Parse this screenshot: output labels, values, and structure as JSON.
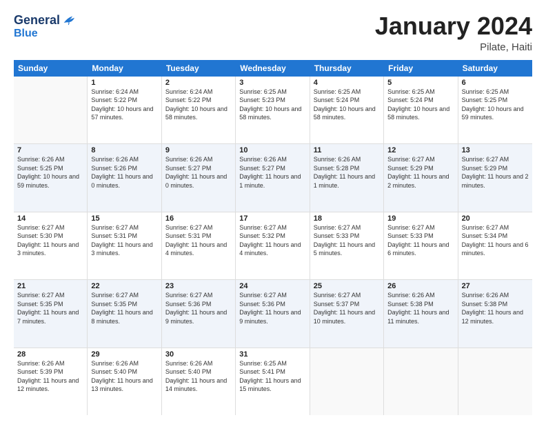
{
  "header": {
    "logo_line1": "General",
    "logo_line2": "Blue",
    "month_title": "January 2024",
    "subtitle": "Pilate, Haiti"
  },
  "weekdays": [
    "Sunday",
    "Monday",
    "Tuesday",
    "Wednesday",
    "Thursday",
    "Friday",
    "Saturday"
  ],
  "weeks": [
    [
      {
        "day": "",
        "sunrise": "",
        "sunset": "",
        "daylight": ""
      },
      {
        "day": "1",
        "sunrise": "Sunrise: 6:24 AM",
        "sunset": "Sunset: 5:22 PM",
        "daylight": "Daylight: 10 hours and 57 minutes."
      },
      {
        "day": "2",
        "sunrise": "Sunrise: 6:24 AM",
        "sunset": "Sunset: 5:22 PM",
        "daylight": "Daylight: 10 hours and 58 minutes."
      },
      {
        "day": "3",
        "sunrise": "Sunrise: 6:25 AM",
        "sunset": "Sunset: 5:23 PM",
        "daylight": "Daylight: 10 hours and 58 minutes."
      },
      {
        "day": "4",
        "sunrise": "Sunrise: 6:25 AM",
        "sunset": "Sunset: 5:24 PM",
        "daylight": "Daylight: 10 hours and 58 minutes."
      },
      {
        "day": "5",
        "sunrise": "Sunrise: 6:25 AM",
        "sunset": "Sunset: 5:24 PM",
        "daylight": "Daylight: 10 hours and 58 minutes."
      },
      {
        "day": "6",
        "sunrise": "Sunrise: 6:25 AM",
        "sunset": "Sunset: 5:25 PM",
        "daylight": "Daylight: 10 hours and 59 minutes."
      }
    ],
    [
      {
        "day": "7",
        "sunrise": "Sunrise: 6:26 AM",
        "sunset": "Sunset: 5:25 PM",
        "daylight": "Daylight: 10 hours and 59 minutes."
      },
      {
        "day": "8",
        "sunrise": "Sunrise: 6:26 AM",
        "sunset": "Sunset: 5:26 PM",
        "daylight": "Daylight: 11 hours and 0 minutes."
      },
      {
        "day": "9",
        "sunrise": "Sunrise: 6:26 AM",
        "sunset": "Sunset: 5:27 PM",
        "daylight": "Daylight: 11 hours and 0 minutes."
      },
      {
        "day": "10",
        "sunrise": "Sunrise: 6:26 AM",
        "sunset": "Sunset: 5:27 PM",
        "daylight": "Daylight: 11 hours and 1 minute."
      },
      {
        "day": "11",
        "sunrise": "Sunrise: 6:26 AM",
        "sunset": "Sunset: 5:28 PM",
        "daylight": "Daylight: 11 hours and 1 minute."
      },
      {
        "day": "12",
        "sunrise": "Sunrise: 6:27 AM",
        "sunset": "Sunset: 5:29 PM",
        "daylight": "Daylight: 11 hours and 2 minutes."
      },
      {
        "day": "13",
        "sunrise": "Sunrise: 6:27 AM",
        "sunset": "Sunset: 5:29 PM",
        "daylight": "Daylight: 11 hours and 2 minutes."
      }
    ],
    [
      {
        "day": "14",
        "sunrise": "Sunrise: 6:27 AM",
        "sunset": "Sunset: 5:30 PM",
        "daylight": "Daylight: 11 hours and 3 minutes."
      },
      {
        "day": "15",
        "sunrise": "Sunrise: 6:27 AM",
        "sunset": "Sunset: 5:31 PM",
        "daylight": "Daylight: 11 hours and 3 minutes."
      },
      {
        "day": "16",
        "sunrise": "Sunrise: 6:27 AM",
        "sunset": "Sunset: 5:31 PM",
        "daylight": "Daylight: 11 hours and 4 minutes."
      },
      {
        "day": "17",
        "sunrise": "Sunrise: 6:27 AM",
        "sunset": "Sunset: 5:32 PM",
        "daylight": "Daylight: 11 hours and 4 minutes."
      },
      {
        "day": "18",
        "sunrise": "Sunrise: 6:27 AM",
        "sunset": "Sunset: 5:33 PM",
        "daylight": "Daylight: 11 hours and 5 minutes."
      },
      {
        "day": "19",
        "sunrise": "Sunrise: 6:27 AM",
        "sunset": "Sunset: 5:33 PM",
        "daylight": "Daylight: 11 hours and 6 minutes."
      },
      {
        "day": "20",
        "sunrise": "Sunrise: 6:27 AM",
        "sunset": "Sunset: 5:34 PM",
        "daylight": "Daylight: 11 hours and 6 minutes."
      }
    ],
    [
      {
        "day": "21",
        "sunrise": "Sunrise: 6:27 AM",
        "sunset": "Sunset: 5:35 PM",
        "daylight": "Daylight: 11 hours and 7 minutes."
      },
      {
        "day": "22",
        "sunrise": "Sunrise: 6:27 AM",
        "sunset": "Sunset: 5:35 PM",
        "daylight": "Daylight: 11 hours and 8 minutes."
      },
      {
        "day": "23",
        "sunrise": "Sunrise: 6:27 AM",
        "sunset": "Sunset: 5:36 PM",
        "daylight": "Daylight: 11 hours and 9 minutes."
      },
      {
        "day": "24",
        "sunrise": "Sunrise: 6:27 AM",
        "sunset": "Sunset: 5:36 PM",
        "daylight": "Daylight: 11 hours and 9 minutes."
      },
      {
        "day": "25",
        "sunrise": "Sunrise: 6:27 AM",
        "sunset": "Sunset: 5:37 PM",
        "daylight": "Daylight: 11 hours and 10 minutes."
      },
      {
        "day": "26",
        "sunrise": "Sunrise: 6:26 AM",
        "sunset": "Sunset: 5:38 PM",
        "daylight": "Daylight: 11 hours and 11 minutes."
      },
      {
        "day": "27",
        "sunrise": "Sunrise: 6:26 AM",
        "sunset": "Sunset: 5:38 PM",
        "daylight": "Daylight: 11 hours and 12 minutes."
      }
    ],
    [
      {
        "day": "28",
        "sunrise": "Sunrise: 6:26 AM",
        "sunset": "Sunset: 5:39 PM",
        "daylight": "Daylight: 11 hours and 12 minutes."
      },
      {
        "day": "29",
        "sunrise": "Sunrise: 6:26 AM",
        "sunset": "Sunset: 5:40 PM",
        "daylight": "Daylight: 11 hours and 13 minutes."
      },
      {
        "day": "30",
        "sunrise": "Sunrise: 6:26 AM",
        "sunset": "Sunset: 5:40 PM",
        "daylight": "Daylight: 11 hours and 14 minutes."
      },
      {
        "day": "31",
        "sunrise": "Sunrise: 6:25 AM",
        "sunset": "Sunset: 5:41 PM",
        "daylight": "Daylight: 11 hours and 15 minutes."
      },
      {
        "day": "",
        "sunrise": "",
        "sunset": "",
        "daylight": ""
      },
      {
        "day": "",
        "sunrise": "",
        "sunset": "",
        "daylight": ""
      },
      {
        "day": "",
        "sunrise": "",
        "sunset": "",
        "daylight": ""
      }
    ]
  ]
}
